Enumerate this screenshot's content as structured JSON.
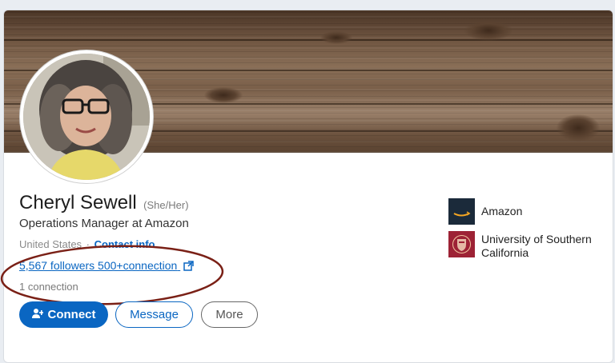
{
  "profile": {
    "name": "Cheryl Sewell",
    "pronouns": "(She/Her)",
    "headline": "Operations Manager at Amazon",
    "location": "United States",
    "separator": "·",
    "contact_info": "Contact info",
    "followers_connections": "5,567 followers 500+connection",
    "mutual_connections": "1 connection"
  },
  "actions": {
    "connect_label": "Connect",
    "message_label": "Message",
    "more_label": "More"
  },
  "organizations": [
    {
      "name": "Amazon",
      "icon": "amazon-logo"
    },
    {
      "name": "University of Southern California",
      "icon": "usc-seal-logo"
    }
  ],
  "colors": {
    "accent": "#0a66c2",
    "annotation": "#7a2016"
  }
}
